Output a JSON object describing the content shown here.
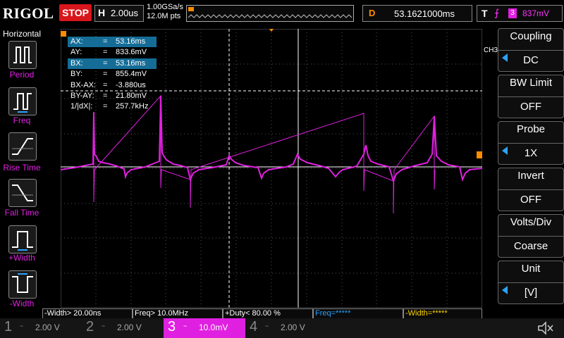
{
  "header": {
    "brand": "RIGOL",
    "run_state": "STOP",
    "timebase_label": "H",
    "timebase": "2.00us",
    "sample_rate": "1.00GSa/s",
    "memory_depth": "12.0M pts",
    "delay_label": "D",
    "delay": "53.1621000ms",
    "trigger_label": "T",
    "trigger_slope": "⨍",
    "trigger_channel": "3",
    "trigger_level": "837mV"
  },
  "left_menu": {
    "title": "Horizontal",
    "items": [
      {
        "label": "Period",
        "icon": "period-icon"
      },
      {
        "label": "Freq",
        "icon": "freq-icon"
      },
      {
        "label": "Rise Time",
        "icon": "rise-time-icon"
      },
      {
        "label": "Fall Time",
        "icon": "fall-time-icon"
      },
      {
        "label": "+Width",
        "icon": "positive-width-icon"
      },
      {
        "label": "-Width",
        "icon": "negative-width-icon"
      }
    ]
  },
  "cursor_readout": [
    {
      "key": "AX:",
      "eq": "=",
      "value": "53.16ms",
      "highlight": true
    },
    {
      "key": "AY:",
      "eq": "=",
      "value": "833.6mV",
      "highlight": false
    },
    {
      "key": "BX:",
      "eq": "=",
      "value": "53.16ms",
      "highlight": true
    },
    {
      "key": "BY:",
      "eq": "=",
      "value": "855.4mV",
      "highlight": false
    },
    {
      "key": "BX-AX:",
      "eq": "=",
      "value": "-3.880us",
      "highlight": false
    },
    {
      "key": "BY-AY:",
      "eq": "=",
      "value": "21.80mV",
      "highlight": false
    },
    {
      "key": "1/|dX|:",
      "eq": "=",
      "value": "257.7kHz",
      "highlight": false
    }
  ],
  "right_menu": {
    "channel_tab": "CH3",
    "items": [
      {
        "title": "Coupling",
        "value": "DC",
        "arrow": true
      },
      {
        "title": "BW Limit",
        "value": "OFF",
        "arrow": false
      },
      {
        "title": "Probe",
        "value": "1X",
        "arrow": true
      },
      {
        "title": "Invert",
        "value": "OFF",
        "arrow": false
      },
      {
        "title": "Volts/Div",
        "value": "Coarse",
        "arrow": false
      },
      {
        "title": "Unit",
        "value": "[V]",
        "arrow": true
      }
    ]
  },
  "measurements": [
    "-Width> 20.00ns",
    "Freq> 10.0MHz",
    "+Duty< 80.00 %",
    "Freq=*****",
    "-Width=*****"
  ],
  "channels": [
    {
      "num": "1",
      "coupling": "~",
      "scale": "2.00 V",
      "active": false
    },
    {
      "num": "2",
      "coupling": "~",
      "scale": "2.00 V",
      "active": false
    },
    {
      "num": "3",
      "coupling": "~",
      "scale": "10.0mV",
      "active": true
    },
    {
      "num": "4",
      "coupling": "~",
      "scale": "2.00 V",
      "active": false
    }
  ],
  "colors": {
    "ch3": "#e020e0",
    "accent": "#ff8c00",
    "stop": "#d8161b",
    "highlight": "#156d97"
  },
  "sound_icon": "speaker-mute-icon"
}
